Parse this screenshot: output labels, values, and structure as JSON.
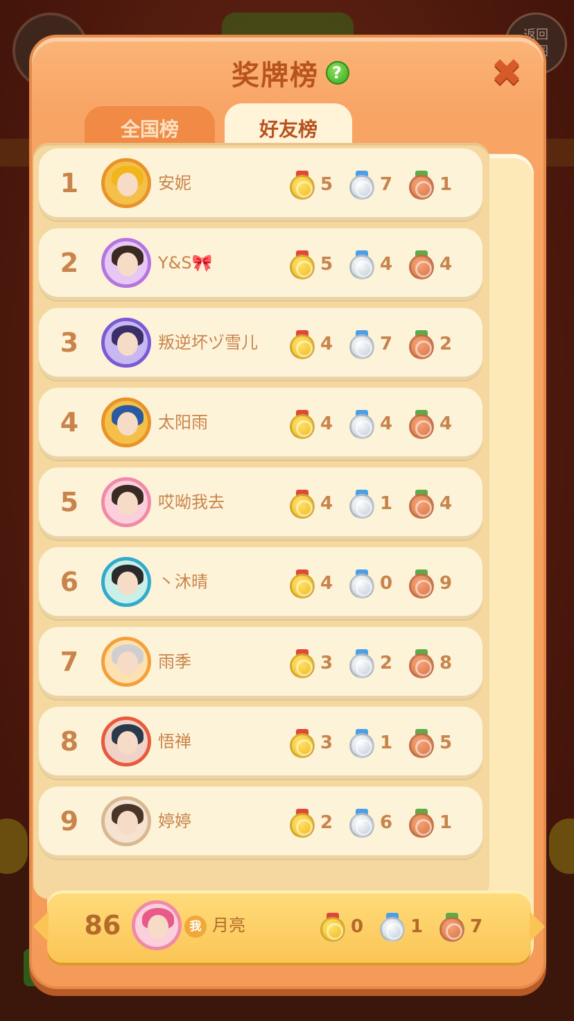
{
  "background": {
    "back_label": "返回\n地图"
  },
  "modal": {
    "title": "奖牌榜",
    "help_icon": "?",
    "close_icon": "✖"
  },
  "tabs": [
    {
      "label": "全国榜",
      "active": false
    },
    {
      "label": "好友榜",
      "active": true
    }
  ],
  "colors": {
    "gold_strap": "#e0463a",
    "silver_strap": "#4aa0e8",
    "bronze_strap": "#5dab46",
    "text_brown": "#c8844a"
  },
  "rows": [
    {
      "rank": "1",
      "name": "安妮",
      "gold": "5",
      "silver": "7",
      "bronze": "1"
    },
    {
      "rank": "2",
      "name": "Y&S🎀",
      "gold": "5",
      "silver": "4",
      "bronze": "4"
    },
    {
      "rank": "3",
      "name": "叛逆坏ヅ雪儿",
      "gold": "4",
      "silver": "7",
      "bronze": "2"
    },
    {
      "rank": "4",
      "name": "太阳雨",
      "gold": "4",
      "silver": "4",
      "bronze": "4"
    },
    {
      "rank": "5",
      "name": "哎呦我去",
      "gold": "4",
      "silver": "1",
      "bronze": "4"
    },
    {
      "rank": "6",
      "name": "丶沐晴",
      "gold": "4",
      "silver": "0",
      "bronze": "9"
    },
    {
      "rank": "7",
      "name": "雨季",
      "gold": "3",
      "silver": "2",
      "bronze": "8"
    },
    {
      "rank": "8",
      "name": "悟禅",
      "gold": "3",
      "silver": "1",
      "bronze": "5"
    },
    {
      "rank": "9",
      "name": "婷婷",
      "gold": "2",
      "silver": "6",
      "bronze": "1"
    }
  ],
  "me": {
    "rank": "86",
    "badge": "我",
    "name": "月亮",
    "gold": "0",
    "silver": "1",
    "bronze": "7"
  }
}
